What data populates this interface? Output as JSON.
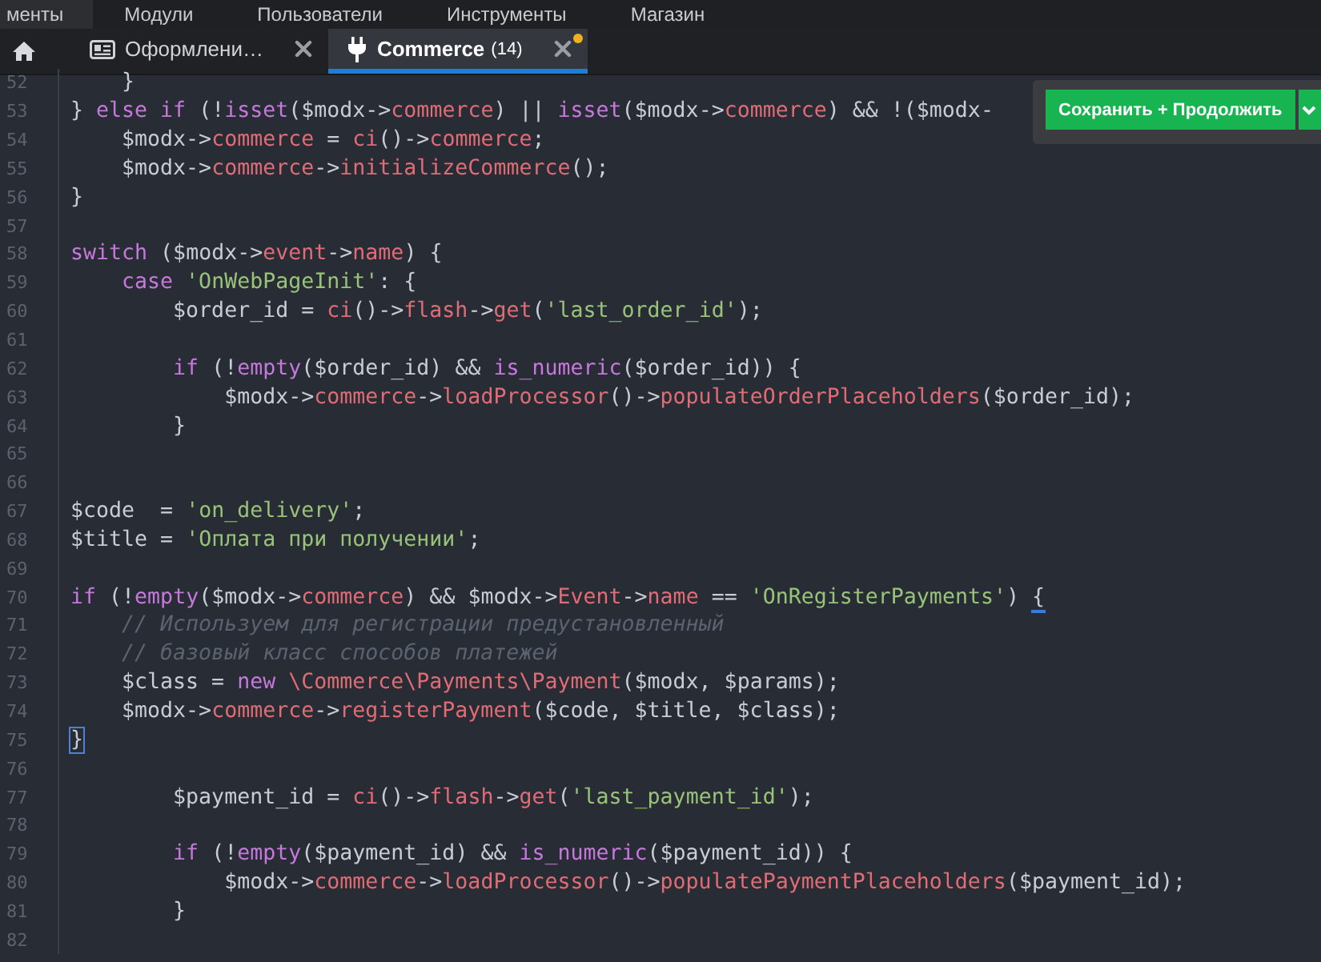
{
  "top_menu": [
    {
      "label": "менты",
      "selected": true
    },
    {
      "label": "Модули",
      "selected": false
    },
    {
      "label": "Пользователи",
      "selected": false
    },
    {
      "label": "Инструменты",
      "selected": false
    },
    {
      "label": "Магазин",
      "selected": false
    }
  ],
  "tabs": [
    {
      "label": "Оформлени…",
      "selected": false,
      "modified": false
    },
    {
      "label": "Commerce",
      "count": "(14)",
      "selected": true,
      "modified": true
    }
  ],
  "save": {
    "label": "Сохранить + Продолжить"
  },
  "editor": {
    "lines": [
      {
        "number": "52",
        "tokens": [
          {
            "kind": "p",
            "text": "    }"
          }
        ]
      },
      {
        "number": "53",
        "tokens": [
          {
            "kind": "p",
            "text": "} "
          },
          {
            "kind": "k",
            "text": "else if"
          },
          {
            "kind": "p",
            "text": " (!"
          },
          {
            "kind": "k",
            "text": "isset"
          },
          {
            "kind": "p",
            "text": "($modx->"
          },
          {
            "kind": "r",
            "text": "commerce"
          },
          {
            "kind": "p",
            "text": ") || "
          },
          {
            "kind": "k",
            "text": "isset"
          },
          {
            "kind": "p",
            "text": "($modx->"
          },
          {
            "kind": "r",
            "text": "commerce"
          },
          {
            "kind": "p",
            "text": ") && !($modx-"
          }
        ]
      },
      {
        "number": "54",
        "tokens": [
          {
            "kind": "p",
            "text": "    $modx->"
          },
          {
            "kind": "r",
            "text": "commerce"
          },
          {
            "kind": "p",
            "text": " = "
          },
          {
            "kind": "r",
            "text": "ci"
          },
          {
            "kind": "p",
            "text": "()->"
          },
          {
            "kind": "r",
            "text": "commerce"
          },
          {
            "kind": "p",
            "text": ";"
          }
        ]
      },
      {
        "number": "55",
        "tokens": [
          {
            "kind": "p",
            "text": "    $modx->"
          },
          {
            "kind": "r",
            "text": "commerce"
          },
          {
            "kind": "p",
            "text": "->"
          },
          {
            "kind": "r",
            "text": "initializeCommerce"
          },
          {
            "kind": "p",
            "text": "();"
          }
        ]
      },
      {
        "number": "56",
        "tokens": [
          {
            "kind": "p",
            "text": "}"
          }
        ]
      },
      {
        "number": "57"
      },
      {
        "number": "58",
        "tokens": [
          {
            "kind": "k",
            "text": "switch"
          },
          {
            "kind": "p",
            "text": " ($modx->"
          },
          {
            "kind": "r",
            "text": "event"
          },
          {
            "kind": "p",
            "text": "->"
          },
          {
            "kind": "r",
            "text": "name"
          },
          {
            "kind": "p",
            "text": ") {"
          }
        ]
      },
      {
        "number": "59",
        "tokens": [
          {
            "kind": "k",
            "text": "    case"
          },
          {
            "kind": "s",
            "text": " 'OnWebPageInit'"
          },
          {
            "kind": "p",
            "text": ": {"
          }
        ]
      },
      {
        "number": "60",
        "tokens": [
          {
            "kind": "p",
            "text": "        $order_id = "
          },
          {
            "kind": "r",
            "text": "ci"
          },
          {
            "kind": "p",
            "text": "()->"
          },
          {
            "kind": "r",
            "text": "flash"
          },
          {
            "kind": "p",
            "text": "->"
          },
          {
            "kind": "r",
            "text": "get"
          },
          {
            "kind": "p",
            "text": "("
          },
          {
            "kind": "s",
            "text": "'last_order_id'"
          },
          {
            "kind": "p",
            "text": ");"
          }
        ]
      },
      {
        "number": "61"
      },
      {
        "number": "62",
        "tokens": [
          {
            "kind": "k",
            "text": "        if"
          },
          {
            "kind": "p",
            "text": " (!"
          },
          {
            "kind": "k",
            "text": "empty"
          },
          {
            "kind": "p",
            "text": "($order_id) && "
          },
          {
            "kind": "k",
            "text": "is_numeric"
          },
          {
            "kind": "p",
            "text": "($order_id)) {"
          }
        ]
      },
      {
        "number": "63",
        "tokens": [
          {
            "kind": "p",
            "text": "            $modx->"
          },
          {
            "kind": "r",
            "text": "commerce"
          },
          {
            "kind": "p",
            "text": "->"
          },
          {
            "kind": "r",
            "text": "loadProcessor"
          },
          {
            "kind": "p",
            "text": "()->"
          },
          {
            "kind": "r",
            "text": "populateOrderPlaceholders"
          },
          {
            "kind": "p",
            "text": "($order_id);"
          }
        ]
      },
      {
        "number": "64",
        "tokens": [
          {
            "kind": "p",
            "text": "        }"
          }
        ]
      },
      {
        "number": "65"
      },
      {
        "number": "66"
      },
      {
        "number": "67",
        "tokens": [
          {
            "kind": "p",
            "text": "$code  = "
          },
          {
            "kind": "s",
            "text": "'on_delivery'"
          },
          {
            "kind": "p",
            "text": ";"
          }
        ]
      },
      {
        "number": "68",
        "tokens": [
          {
            "kind": "p",
            "text": "$title = "
          },
          {
            "kind": "s",
            "text": "'Оплата при получении'"
          },
          {
            "kind": "p",
            "text": ";"
          }
        ]
      },
      {
        "number": "69"
      },
      {
        "number": "70",
        "tokens": [
          {
            "kind": "k",
            "text": "if"
          },
          {
            "kind": "p",
            "text": " (!"
          },
          {
            "kind": "k",
            "text": "empty"
          },
          {
            "kind": "p",
            "text": "($modx->"
          },
          {
            "kind": "r",
            "text": "commerce"
          },
          {
            "kind": "p",
            "text": ") && $modx->"
          },
          {
            "kind": "r",
            "text": "Event"
          },
          {
            "kind": "p",
            "text": "->"
          },
          {
            "kind": "r",
            "text": "name"
          },
          {
            "kind": "p",
            "text": " == "
          },
          {
            "kind": "s",
            "text": "'OnRegisterPayments'"
          },
          {
            "kind": "p",
            "text": ") "
          },
          {
            "kind": "m",
            "text": "{"
          }
        ]
      },
      {
        "number": "71",
        "tokens": [
          {
            "kind": "c",
            "text": "    // Используем для регистрации предустановленный"
          }
        ]
      },
      {
        "number": "72",
        "tokens": [
          {
            "kind": "c",
            "text": "    // базовый класс способов платежей"
          }
        ]
      },
      {
        "number": "73",
        "tokens": [
          {
            "kind": "p",
            "text": "    $class = "
          },
          {
            "kind": "k",
            "text": "new"
          },
          {
            "kind": "r",
            "text": " \\Commerce\\Payments\\Payment"
          },
          {
            "kind": "p",
            "text": "($modx, $params);"
          }
        ]
      },
      {
        "number": "74",
        "tokens": [
          {
            "kind": "p",
            "text": "    $modx->"
          },
          {
            "kind": "r",
            "text": "commerce"
          },
          {
            "kind": "p",
            "text": "->"
          },
          {
            "kind": "r",
            "text": "registerPayment"
          },
          {
            "kind": "p",
            "text": "($code, $title, $class);"
          }
        ]
      },
      {
        "number": "75",
        "tokens": [
          {
            "kind": "b",
            "text": "}"
          }
        ]
      },
      {
        "number": "76"
      },
      {
        "number": "77",
        "tokens": [
          {
            "kind": "p",
            "text": "        $payment_id = "
          },
          {
            "kind": "r",
            "text": "ci"
          },
          {
            "kind": "p",
            "text": "()->"
          },
          {
            "kind": "r",
            "text": "flash"
          },
          {
            "kind": "p",
            "text": "->"
          },
          {
            "kind": "r",
            "text": "get"
          },
          {
            "kind": "p",
            "text": "("
          },
          {
            "kind": "s",
            "text": "'last_payment_id'"
          },
          {
            "kind": "p",
            "text": ");"
          }
        ]
      },
      {
        "number": "78"
      },
      {
        "number": "79",
        "tokens": [
          {
            "kind": "k",
            "text": "        if"
          },
          {
            "kind": "p",
            "text": " (!"
          },
          {
            "kind": "k",
            "text": "empty"
          },
          {
            "kind": "p",
            "text": "($payment_id) && "
          },
          {
            "kind": "k",
            "text": "is_numeric"
          },
          {
            "kind": "p",
            "text": "($payment_id)) {"
          }
        ]
      },
      {
        "number": "80",
        "tokens": [
          {
            "kind": "p",
            "text": "            $modx->"
          },
          {
            "kind": "r",
            "text": "commerce"
          },
          {
            "kind": "p",
            "text": "->"
          },
          {
            "kind": "r",
            "text": "loadProcessor"
          },
          {
            "kind": "p",
            "text": "()->"
          },
          {
            "kind": "r",
            "text": "populatePaymentPlaceholders"
          },
          {
            "kind": "p",
            "text": "($payment_id);"
          }
        ]
      },
      {
        "number": "81",
        "tokens": [
          {
            "kind": "p",
            "text": "        }"
          }
        ]
      },
      {
        "number": "82"
      }
    ]
  }
}
